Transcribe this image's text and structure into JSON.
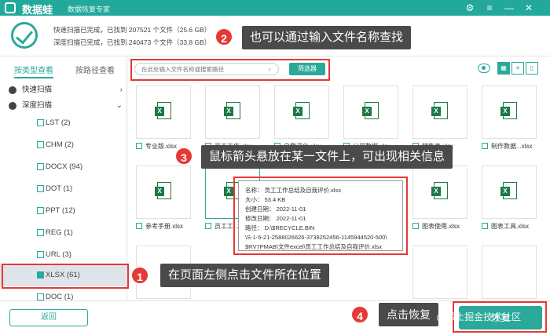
{
  "app": {
    "name": "数据蛙",
    "subtitle": "数据恢复专家"
  },
  "window": {
    "menu": "≡",
    "minimize": "—",
    "close": "✕"
  },
  "scan": {
    "quick_text": "快速扫描已完成，已找到 207521 个文件（25.6 GB）",
    "deep_text": "深度扫描已完成，已找到 240473 个文件（33.8 GB）"
  },
  "sidebar": {
    "tabs": [
      "按类型查看",
      "按路径查看"
    ],
    "quick_label": "快速扫描",
    "deep_label": "深度扫描",
    "items": [
      {
        "label": "LST (2)"
      },
      {
        "label": "CHM (2)"
      },
      {
        "label": "DOCX (94)"
      },
      {
        "label": "DOT (1)"
      },
      {
        "label": "PPT (12)"
      },
      {
        "label": "REG (1)"
      },
      {
        "label": "URL (3)"
      },
      {
        "label": "XLSX (61)"
      },
      {
        "label": "DOC (1)"
      }
    ]
  },
  "toolbar": {
    "search_placeholder": "在此处输入文件名称或搜索路径",
    "filter_label": "筛选器"
  },
  "files": [
    {
      "name": "专业版.xlsx"
    },
    {
      "name": "员工工作.xlsx"
    },
    {
      "name": "自我评价.xlsx"
    },
    {
      "name": "公司数据.xlsx"
    },
    {
      "name": "销售表.xlsx"
    },
    {
      "name": "工资表.xlsx"
    },
    {
      "name": "制作数据...xlsx"
    },
    {
      "name": "参考手册.xlsx"
    },
    {
      "name": "员工工..."
    },
    {
      "name": ""
    },
    {
      "name": ""
    },
    {
      "name": ""
    },
    {
      "name": "图表使用.xlsx"
    },
    {
      "name": "图表工具.xlsx"
    }
  ],
  "tooltip": {
    "name": "名称：  员工工作总结及自我评价.xlsx",
    "size": "大小：  53.4 KB",
    "created": "创建日期：  2022-11-01",
    "modified": "修改日期：  2022-11-01",
    "path1": "路径：  D:\\$RECYCLE.BIN",
    "path2": "\\S-1-5-21-2588026626-3738252456-1145944520-500\\",
    "path3": "$RV7PMAB\\文件excel\\员工工作总结及自我评价.xlsx"
  },
  "callouts": [
    {
      "num": "1",
      "text": "在页面左侧点击文件所在位置"
    },
    {
      "num": "2",
      "text": "也可以通过输入文件名称查找"
    },
    {
      "num": "3",
      "text": "鼠标箭头悬放在某一文件上，可出现相关信息"
    },
    {
      "num": "4",
      "text": "点击恢复"
    }
  ],
  "bottom": {
    "back_label": "返回",
    "recover_label": "恢复"
  },
  "watermark": "@稀土掘金技术社区",
  "colors": {
    "accent": "#2aa99a",
    "highlight": "#e53935"
  }
}
